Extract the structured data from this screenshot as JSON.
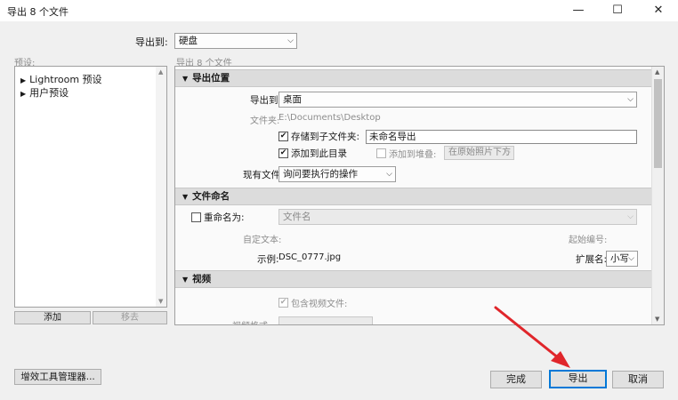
{
  "window": {
    "title": "导出 8 个文件",
    "min_symbol": "—",
    "max_symbol": "☐",
    "close_symbol": "✕"
  },
  "export_to": {
    "label": "导出到:",
    "value": "硬盘"
  },
  "presets": {
    "header": "预设:",
    "items": [
      {
        "label": "Lightroom 预设"
      },
      {
        "label": "用户预设"
      }
    ],
    "add_button": "添加",
    "remove_button": "移去"
  },
  "settings_header": "导出 8 个文件",
  "location": {
    "title": "导出位置",
    "export_to_label": "导出到:",
    "export_to_value": "桌面",
    "folder_label": "文件夹:",
    "folder_value": "E:\\Documents\\Desktop",
    "subfolder_label": "存储到子文件夹:",
    "subfolder_value": "未命名导出",
    "add_catalog_label": "添加到此目录",
    "add_stack_label": "添加到堆叠:",
    "stack_position": "在原始照片下方",
    "existing_label": "现有文件:",
    "existing_value": "询问要执行的操作"
  },
  "naming": {
    "title": "文件命名",
    "rename_label": "重命名为:",
    "rename_value": "文件名",
    "custom_text_label": "自定文本:",
    "start_number_label": "起始编号:",
    "example_label": "示例:",
    "example_value": "DSC_0777.jpg",
    "extension_label": "扩展名:",
    "extension_value": "小写"
  },
  "video": {
    "title": "视频",
    "include_label": "包含视频文件:",
    "format_label": "视频格式:"
  },
  "buttons": {
    "plugin_manager": "增效工具管理器...",
    "done": "完成",
    "export": "导出",
    "cancel": "取消"
  },
  "colors": {
    "arrow": "#e0262b",
    "focus": "#0078d7"
  }
}
